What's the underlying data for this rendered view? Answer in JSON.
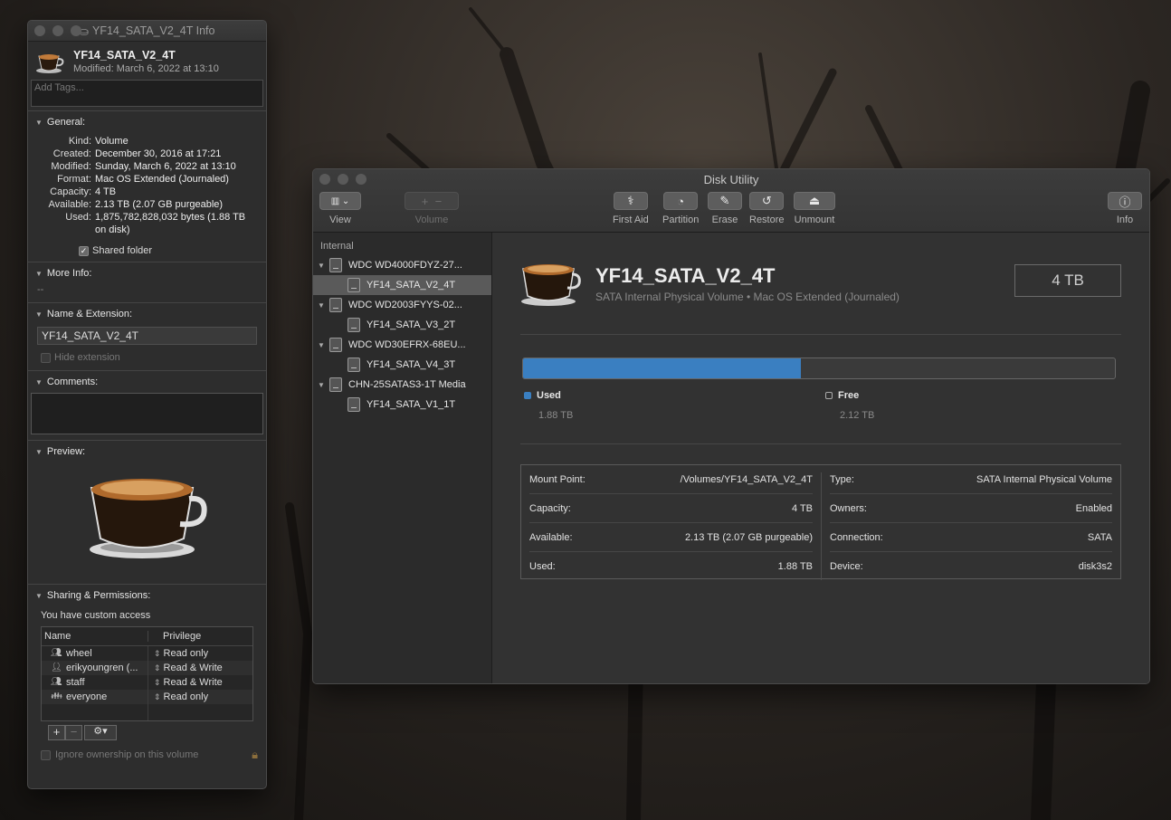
{
  "info_window": {
    "title": "YF14_SATA_V2_4T Info",
    "name": "YF14_SATA_V2_4T",
    "modified": "Modified: March 6, 2022 at 13:10",
    "tags_placeholder": "Add Tags...",
    "general": {
      "header": "General:",
      "rows": [
        {
          "k": "Kind:",
          "v": "Volume"
        },
        {
          "k": "Created:",
          "v": "December 30, 2016 at 17:21"
        },
        {
          "k": "Modified:",
          "v": "Sunday, March 6, 2022 at 13:10"
        },
        {
          "k": "Format:",
          "v": "Mac OS Extended (Journaled)"
        },
        {
          "k": "Capacity:",
          "v": "4 TB"
        },
        {
          "k": "Available:",
          "v": "2.13 TB (2.07 GB purgeable)"
        },
        {
          "k": "Used:",
          "v": "1,875,782,828,032 bytes (1.88 TB on disk)"
        }
      ],
      "shared_folder": "Shared folder"
    },
    "more_info": {
      "header": "More Info:",
      "value": "--"
    },
    "name_ext": {
      "header": "Name & Extension:",
      "value": "YF14_SATA_V2_4T",
      "hide_extension": "Hide extension"
    },
    "comments": {
      "header": "Comments:"
    },
    "preview": {
      "header": "Preview:"
    },
    "sharing": {
      "header": "Sharing & Permissions:",
      "access": "You have custom access",
      "col_name": "Name",
      "col_privilege": "Privilege",
      "rows": [
        {
          "name": "wheel",
          "priv": "Read only",
          "icon": "group-icon"
        },
        {
          "name": "erikyoungren (...",
          "priv": "Read & Write",
          "icon": "user-icon"
        },
        {
          "name": "staff",
          "priv": "Read & Write",
          "icon": "group-icon"
        },
        {
          "name": "everyone",
          "priv": "Read only",
          "icon": "everyone-icon"
        }
      ],
      "ignore_ownership": "Ignore ownership on this volume"
    }
  },
  "disk_utility": {
    "title": "Disk Utility",
    "toolbar": {
      "view": "View",
      "volume": "Volume",
      "first_aid": "First Aid",
      "partition": "Partition",
      "erase": "Erase",
      "restore": "Restore",
      "unmount": "Unmount",
      "info": "Info"
    },
    "sidebar": {
      "section": "Internal",
      "disks": [
        {
          "name": "WDC WD4000FDYZ-27...",
          "volume": "YF14_SATA_V2_4T"
        },
        {
          "name": "WDC WD2003FYYS-02...",
          "volume": "YF14_SATA_V3_2T"
        },
        {
          "name": "WDC WD30EFRX-68EU...",
          "volume": "YF14_SATA_V4_3T"
        },
        {
          "name": "CHN-25SATAS3-1T Media",
          "volume": "YF14_SATA_V1_1T"
        }
      ]
    },
    "volume": {
      "name": "YF14_SATA_V2_4T",
      "subtitle": "SATA Internal Physical Volume • Mac OS Extended (Journaled)",
      "size": "4 TB",
      "used_fraction": 0.47,
      "used_label": "Used",
      "used_value": "1.88 TB",
      "free_label": "Free",
      "free_value": "2.12 TB",
      "colors": {
        "used": "#3a7fc1",
        "free": "#3a3a3a"
      }
    },
    "details": {
      "left": [
        {
          "k": "Mount Point:",
          "v": "/Volumes/YF14_SATA_V2_4T"
        },
        {
          "k": "Capacity:",
          "v": "4 TB"
        },
        {
          "k": "Available:",
          "v": "2.13 TB (2.07 GB purgeable)"
        },
        {
          "k": "Used:",
          "v": "1.88 TB"
        }
      ],
      "right": [
        {
          "k": "Type:",
          "v": "SATA Internal Physical Volume"
        },
        {
          "k": "Owners:",
          "v": "Enabled"
        },
        {
          "k": "Connection:",
          "v": "SATA"
        },
        {
          "k": "Device:",
          "v": "disk3s2"
        }
      ]
    }
  }
}
